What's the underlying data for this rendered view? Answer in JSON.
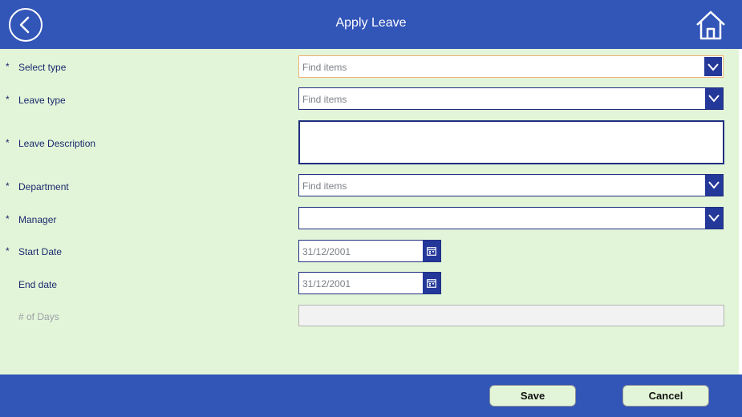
{
  "header": {
    "title": "Apply Leave",
    "back_icon": "chevron-left-icon",
    "home_icon": "home-icon"
  },
  "theme": {
    "primary": "#3255b8",
    "form_bg": "#e3f5d8",
    "field_border": "#1f2f80",
    "focus_border": "#f0b178"
  },
  "form": {
    "required_marker": "*",
    "select_type": {
      "label": "Select type",
      "placeholder": "Find items"
    },
    "leave_type": {
      "label": "Leave type",
      "placeholder": "Find items"
    },
    "leave_description": {
      "label": "Leave Description",
      "value": ""
    },
    "department": {
      "label": "Department",
      "placeholder": "Find items"
    },
    "manager": {
      "label": "Manager",
      "placeholder": ""
    },
    "start_date": {
      "label": "Start Date",
      "value": "31/12/2001"
    },
    "end_date": {
      "label": "End date",
      "value": "31/12/2001"
    },
    "num_days": {
      "label": "# of Days",
      "value": ""
    }
  },
  "footer": {
    "save_label": "Save",
    "cancel_label": "Cancel"
  }
}
